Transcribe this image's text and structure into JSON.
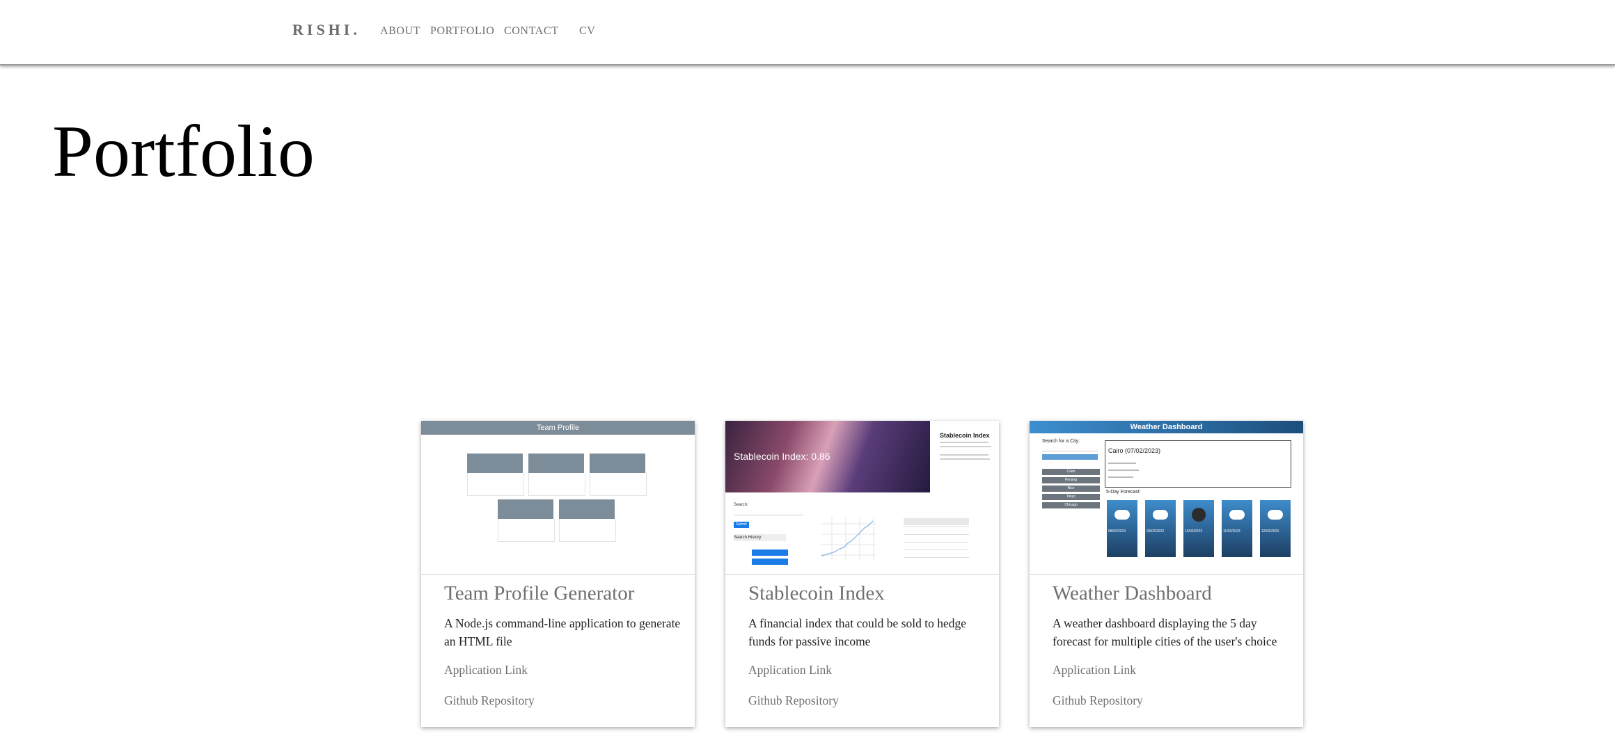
{
  "nav": {
    "brand": "RISHI.",
    "links": [
      "ABOUT",
      "PORTFOLIO",
      "CONTACT",
      "CV"
    ]
  },
  "page_title": "Portfolio",
  "cards": [
    {
      "title": "Team Profile Generator",
      "description": "A Node.js command-line application to generate an HTML file",
      "link1": "Application Link",
      "link2": "Github Repository",
      "preview": {
        "header": "Team Profile"
      }
    },
    {
      "title": "Stablecoin Index",
      "description": "A financial index that could be sold to hedge funds for passive income",
      "link1": "Application Link",
      "link2": "Github Repository",
      "preview": {
        "banner": "Stablecoin Index: 0.86",
        "side_title": "Stablecoin Index",
        "search_label": "Search:",
        "search_button": "Submit",
        "history_label": "Search History:"
      }
    },
    {
      "title": "Weather Dashboard",
      "description": "A weather dashboard displaying the 5 day forecast for multiple cities of the user's choice",
      "link1": "Application Link",
      "link2": "Github Repository",
      "preview": {
        "header": "Weather Dashboard",
        "search_label": "Search for a City:",
        "current": "Cairo (07/02/2023)",
        "forecast_label": "5-Day Forecast:",
        "cities": [
          "Cairo",
          "Penang",
          "Nice",
          "Tokyo",
          "Chicago"
        ],
        "days": [
          "08/02/2023",
          "09/02/2023",
          "10/02/2023",
          "11/02/2023",
          "12/02/2023"
        ]
      }
    }
  ],
  "colors": {
    "accent_blue": "#2f79b5",
    "nav_text": "#6c6c6c"
  }
}
